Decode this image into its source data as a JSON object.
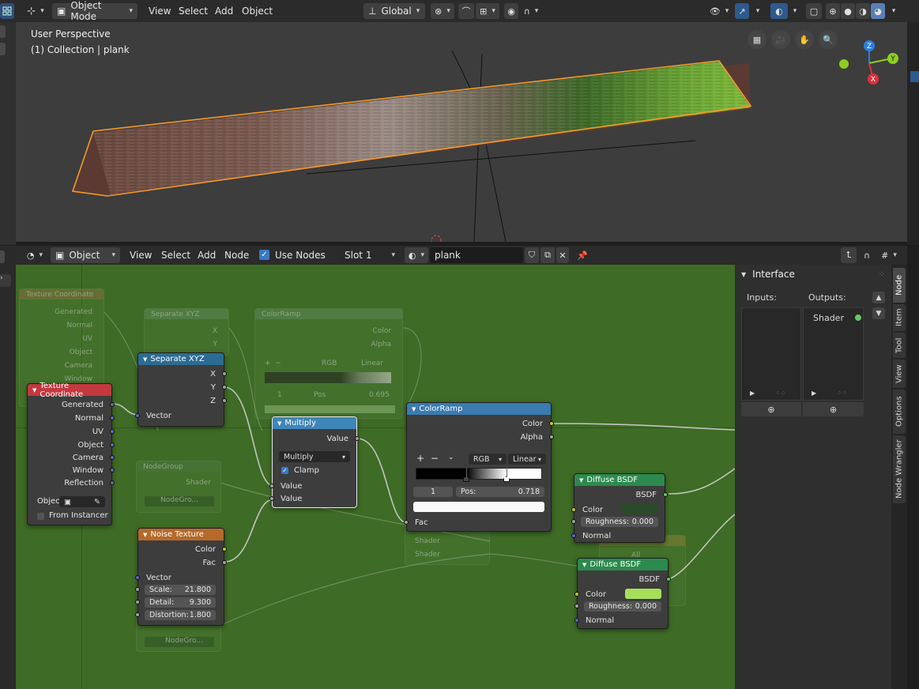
{
  "top_header": {
    "mode": "Object Mode",
    "menus": [
      "View",
      "Select",
      "Add",
      "Object"
    ],
    "orientation": "Global"
  },
  "viewport": {
    "perspective": "User Perspective",
    "collection": "(1) Collection | plank",
    "axes": {
      "x": "X",
      "y": "Y",
      "z": "Z"
    }
  },
  "node_header": {
    "object": "Object",
    "menus": [
      "View",
      "Select",
      "Add",
      "Node"
    ],
    "use_nodes": "Use Nodes",
    "slot": "Slot 1",
    "material": "plank"
  },
  "nodes": {
    "texture_coordinate": {
      "title": "Texture Coordinate",
      "outputs": [
        "Generated",
        "Normal",
        "UV",
        "Object",
        "Camera",
        "Window",
        "Reflection"
      ],
      "object_label": "Objec",
      "from_instancer": "From Instancer"
    },
    "separate_xyz": {
      "title": "Separate XYZ",
      "outputs": [
        "X",
        "Y",
        "Z"
      ],
      "input": "Vector"
    },
    "multiply": {
      "title": "Multiply",
      "output": "Value",
      "operation": "Multiply",
      "clamp": "Clamp",
      "inputs": [
        "Value",
        "Value"
      ]
    },
    "colorramp": {
      "title": "ColorRamp",
      "outputs": [
        "Color",
        "Alpha"
      ],
      "mode": "RGB",
      "interpolation": "Linear",
      "index": "1",
      "pos_label": "Pos:",
      "pos_value": "0.718",
      "input": "Fac",
      "stop_positions": [
        0.4,
        0.718
      ]
    },
    "noise_texture": {
      "title": "Noise Texture",
      "outputs": [
        "Color",
        "Fac"
      ],
      "input": "Vector",
      "fields": [
        {
          "label": "Scale:",
          "value": "21.800"
        },
        {
          "label": "Detail:",
          "value": "9.300"
        },
        {
          "label": "Distortion:",
          "value": "1.800"
        }
      ]
    },
    "diffuse1": {
      "title": "Diffuse BSDF",
      "output": "BSDF",
      "color_label": "Color",
      "color": "#2a4a2a",
      "roughness_label": "Roughness:",
      "roughness": "0.000",
      "normal": "Normal"
    },
    "diffuse2": {
      "title": "Diffuse BSDF",
      "output": "BSDF",
      "color_label": "Color",
      "color": "#a6e05a",
      "roughness_label": "Roughness:",
      "roughness": "0.000",
      "normal": "Normal"
    }
  },
  "ghost_nodes": {
    "tex_coord": {
      "title": "Texture Coordinate",
      "outputs": [
        "Generated",
        "Normal",
        "UV",
        "Object",
        "Camera",
        "Window"
      ]
    },
    "sep_xyz": {
      "title": "Separate XYZ",
      "outputs": [
        "X",
        "Y"
      ]
    },
    "colorramp": {
      "title": "ColorRamp",
      "outputs": [
        "Color",
        "Alpha"
      ],
      "mode": "RGB",
      "interp": "Linear",
      "index": "1",
      "pos": "Pos",
      "val": "0.695"
    },
    "group1": {
      "title": "NodeGroup",
      "output": "Shader",
      "label": "NodeGro..."
    },
    "mix": {
      "inputs": [
        "Shader",
        "Shader"
      ]
    },
    "group2": {
      "label": "NodeGro..."
    },
    "right": {
      "label": "All"
    }
  },
  "npanel": {
    "title": "Interface",
    "inputs_label": "Inputs:",
    "outputs_label": "Outputs:",
    "output_item": "Shader"
  },
  "ntabs": [
    "Node",
    "Item",
    "Tool",
    "View",
    "Options",
    "Node Wrangler"
  ]
}
